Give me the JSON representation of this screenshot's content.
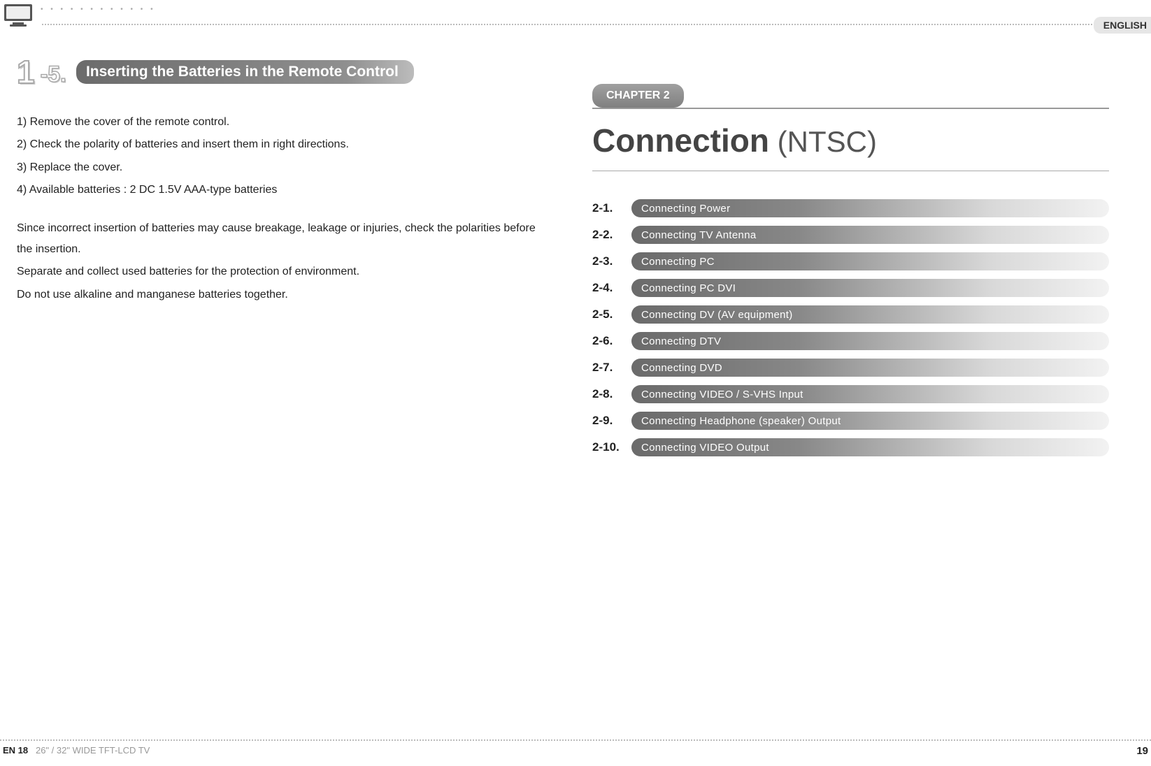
{
  "header": {
    "language_tab": "ENGLISH",
    "dots": "• • • • • • • • • • • •"
  },
  "left": {
    "section_number_main": "1",
    "section_number_sub": "-5.",
    "section_title": "Inserting the Batteries in the Remote Control",
    "lines": [
      "1) Remove the cover of the remote control.",
      "2) Check the polarity of batteries and insert them in right directions.",
      "3) Replace the cover.",
      "4) Available batteries : 2 DC 1.5V AAA-type batteries"
    ],
    "notes": [
      "Since incorrect insertion of batteries may cause breakage, leakage or injuries, check the polarities before the insertion.",
      "Separate and collect used batteries for the protection of environment.",
      "Do not use alkaline and manganese batteries together."
    ]
  },
  "right": {
    "chapter_label": "CHAPTER 2",
    "chapter_title_bold": "Connection",
    "chapter_title_light": "(NTSC)",
    "toc": [
      {
        "num": "2-1.",
        "label": "Connecting Power"
      },
      {
        "num": "2-2.",
        "label": "Connecting TV Antenna"
      },
      {
        "num": "2-3.",
        "label": "Connecting PC"
      },
      {
        "num": "2-4.",
        "label": "Connecting PC DVI"
      },
      {
        "num": "2-5.",
        "label": "Connecting DV (AV equipment)"
      },
      {
        "num": "2-6.",
        "label": "Connecting DTV"
      },
      {
        "num": "2-7.",
        "label": "Connecting DVD"
      },
      {
        "num": "2-8.",
        "label": "Connecting VIDEO / S-VHS Input"
      },
      {
        "num": "2-9.",
        "label": "Connecting Headphone (speaker) Output"
      },
      {
        "num": "2-10.",
        "label": "Connecting VIDEO Output"
      }
    ]
  },
  "footer": {
    "left_page_prefix": "EN 18",
    "left_page_text": "26\" / 32\" WIDE TFT-LCD TV",
    "right_page": "19"
  }
}
